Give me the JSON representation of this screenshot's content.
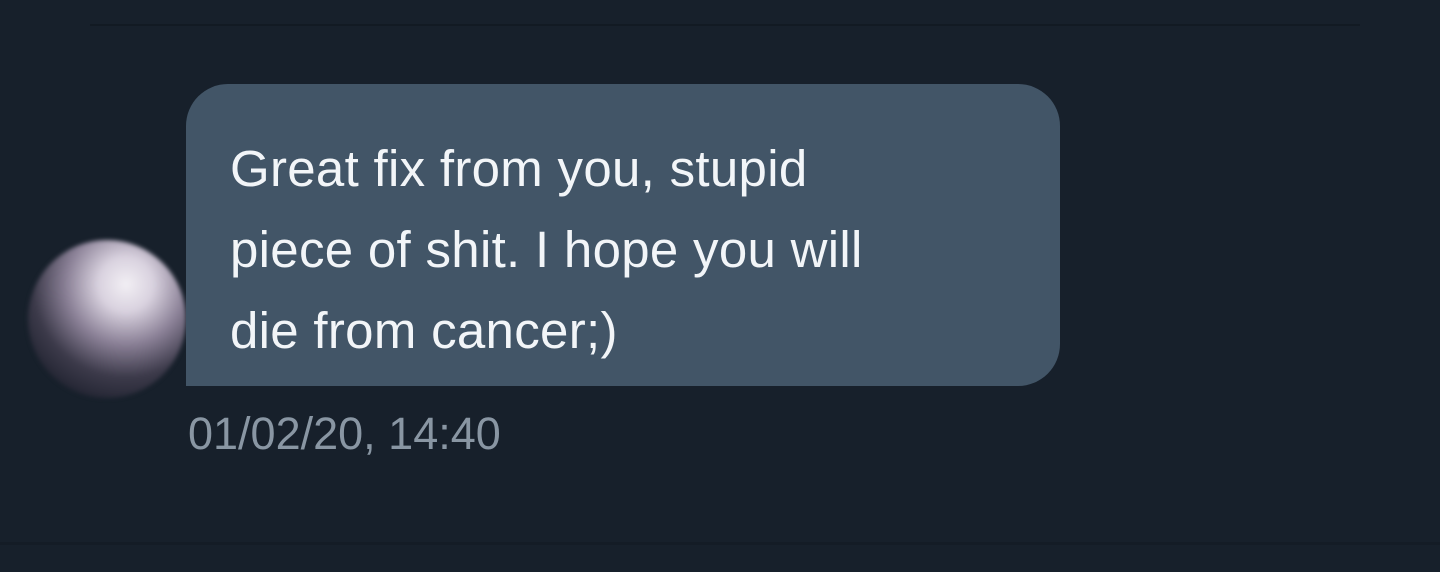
{
  "message": {
    "text": "Great fix from you, stupid\npiece of shit. I hope you will\ndie from cancer;)",
    "timestamp": "01/02/20, 14:40"
  },
  "colors": {
    "background": "#17202b",
    "bubble": "#425567",
    "message_text": "#f2f5f8",
    "timestamp_text": "#8996a3"
  }
}
